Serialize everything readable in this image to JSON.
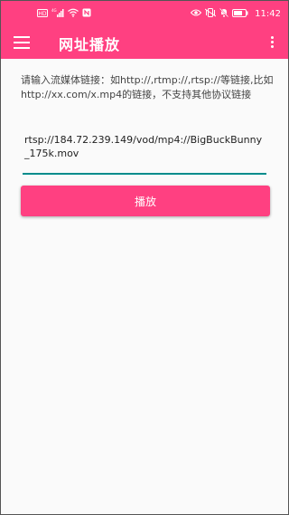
{
  "status_bar": {
    "left_icons": [
      "hd-icon",
      "signal-4g-icon",
      "wifi-icon",
      "nfc-icon"
    ],
    "right_icons": [
      "eye-comfort-icon",
      "vibrate-icon",
      "mute-icon",
      "battery-icon"
    ],
    "left_text": {
      "hd": "HD",
      "signal": "4G"
    },
    "time": "11:42"
  },
  "toolbar": {
    "title": "网址播放",
    "menu_icon": "hamburger-menu-icon",
    "more_icon": "more-vertical-icon"
  },
  "main": {
    "hint": "请输入流媒体链接：如http://,rtmp://,rtsp://等链接,比如http://xx.com/x.mp4的链接，不支持其他协议链接",
    "url_value": "rtsp://184.72.239.149/vod/mp4://BigBuckBunny_175k.mov",
    "play_label": "播放"
  },
  "colors": {
    "accent": "#ff4081",
    "input_underline": "#008c8c",
    "background": "#fafafa"
  }
}
